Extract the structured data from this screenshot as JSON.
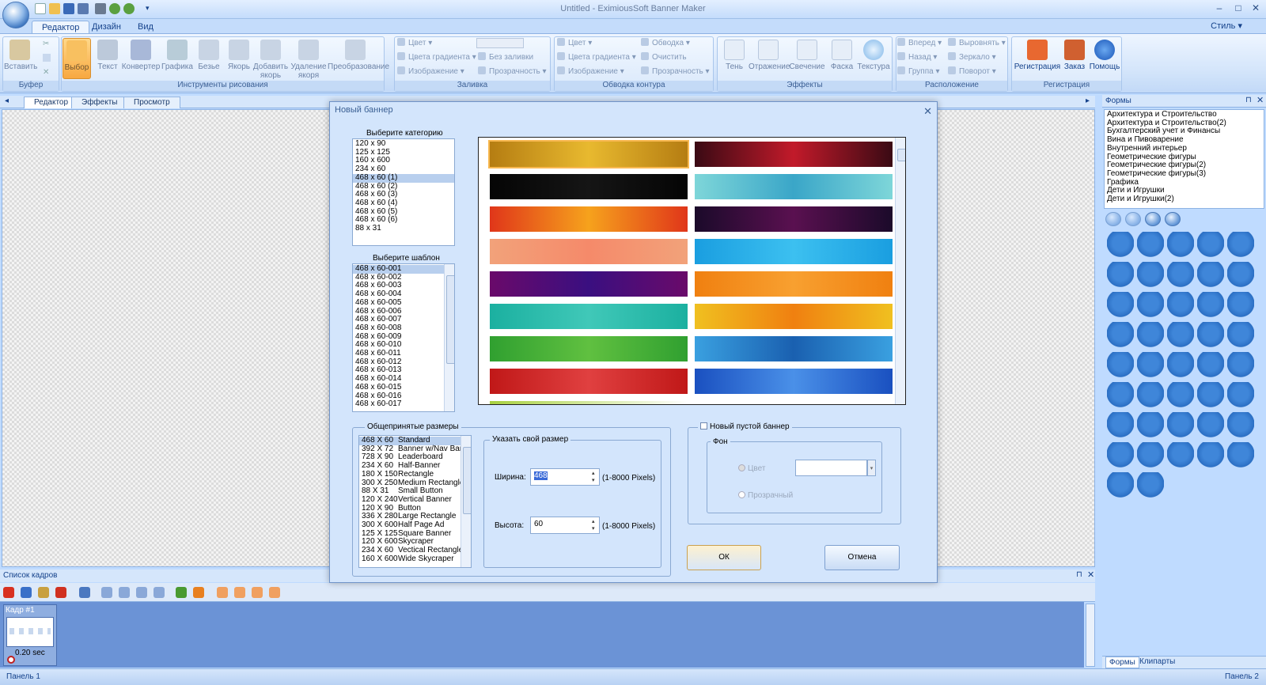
{
  "app": {
    "title": "Untitled - EximiousSoft Banner Maker",
    "style_label": "Стиль"
  },
  "ribbon_tabs": [
    "Редактор",
    "Дизайн",
    "Вид"
  ],
  "ribbon": {
    "groups": [
      {
        "label": "Буфер",
        "buttons": [
          "Вставить"
        ]
      },
      {
        "label": "Инструменты рисования",
        "buttons": [
          "Выбор",
          "Текст",
          "Конвертер",
          "Графика",
          "Безье",
          "Якорь",
          "Добавить якорь",
          "Удаление якоря",
          "Преобразование"
        ]
      },
      {
        "label": "Заливка",
        "items": [
          "Цвет",
          "Цвета градиента",
          "Без заливки",
          "Изображение",
          "Прозрачность"
        ]
      },
      {
        "label": "Обводка контура",
        "items": [
          "Цвет",
          "Обводка",
          "Цвета градиента",
          "Очистить",
          "Изображение",
          "Прозрачность"
        ]
      },
      {
        "label": "Эффекты",
        "buttons": [
          "Тень",
          "Отражение",
          "Свечение",
          "Фаска",
          "Текстура"
        ]
      },
      {
        "label": "Расположение",
        "items": [
          "Вперед",
          "Выровнять",
          "Назад",
          "Зеркало",
          "Группа",
          "Поворот"
        ]
      },
      {
        "label": "Регистрация",
        "buttons": [
          "Регистрация",
          "Заказ",
          "Помощь"
        ]
      }
    ]
  },
  "doc_tabs": [
    "Редактор",
    "Эффекты",
    "Просмотр"
  ],
  "right_panel": {
    "title": "Формы",
    "categories": [
      "Архитектура и Строительство",
      "Архитектура и Строительство(2)",
      "Бухгалтерский учет и Финансы",
      "Вина и Пивоварение",
      "Внутренний интерьер",
      "Геометрические фигуры",
      "Геометрические фигуры(2)",
      "Геометрические фигуры(3)",
      "Графика",
      "Дети и Игрушки",
      "Дети и Игрушки(2)"
    ],
    "tabs": [
      "Формы",
      "Клипарты"
    ],
    "icon_names": [
      "airplane-icon",
      "ski-icon",
      "bug-icon",
      "car-front-icon",
      "car-side-icon",
      "truck-icon",
      "bus-icon",
      "motorbike-icon",
      "boat-icon",
      "van-icon",
      "jeep-icon",
      "rocket-icon",
      "bicycle-icon",
      "scooter-icon",
      "tractor-icon",
      "ship-icon",
      "satellite-icon",
      "jetski-icon",
      "helicopter-icon",
      "gear-icon",
      "van2-icon",
      "bus2-icon",
      "lorry-icon",
      "car2-icon",
      "atv-icon",
      "digger-icon",
      "truck2-icon",
      "plane-icon",
      "missile-icon",
      "cart-icon",
      "spaceship-icon",
      "balloon-icon",
      "bike2-icon",
      "tram-icon",
      "ambulance-icon",
      "jet-icon",
      "helicopter2-icon",
      "steamboat-icon",
      "boat2-icon",
      "sedan-icon",
      "train-icon",
      "bus3-icon"
    ]
  },
  "frames": {
    "title": "Список кадров",
    "frame_label": "Кадр #1",
    "frame_time": "0.20 sec"
  },
  "status": {
    "left": "Панель 1",
    "right": "Панель 2"
  },
  "dialog": {
    "title": "Новый баннер",
    "category_label": "Выберите категорию",
    "categories": [
      "120 x 90",
      "125 x 125",
      "160 x 600",
      "234 x 60",
      "468 x 60 (1)",
      "468 x 60 (2)",
      "468 x 60 (3)",
      "468 x 60 (4)",
      "468 x 60 (5)",
      "468 x 60 (6)",
      "88 x 31"
    ],
    "selected_category": "468 x 60 (1)",
    "template_label": "Выберите шаблон",
    "templates": [
      "468 x 60-001",
      "468 x 60-002",
      "468 x 60-003",
      "468 x 60-004",
      "468 x 60-005",
      "468 x 60-006",
      "468 x 60-007",
      "468 x 60-008",
      "468 x 60-009",
      "468 x 60-010",
      "468 x 60-011",
      "468 x 60-012",
      "468 x 60-013",
      "468 x 60-014",
      "468 x 60-015",
      "468 x 60-016",
      "468 x 60-017"
    ],
    "selected_template": "468 x 60-001",
    "thumb_colors": [
      [
        "#b57d12",
        "#e8b92f"
      ],
      [
        "#3a0a14",
        "#c21a2a"
      ],
      [
        "#050505",
        "#151515"
      ],
      [
        "#7ed6d9",
        "#3aa6c8"
      ],
      [
        "#e0361a",
        "#f6a21c"
      ],
      [
        "#1b0a2a",
        "#5a1050"
      ],
      [
        "#f2a27a",
        "#f58a6a"
      ],
      [
        "#1a9ee0",
        "#3cc0f0"
      ],
      [
        "#6a0a6a",
        "#3a0f80"
      ],
      [
        "#f08010",
        "#f8a030"
      ],
      [
        "#1bb0a0",
        "#40c8b8"
      ],
      [
        "#f0c020",
        "#f08010"
      ],
      [
        "#30a030",
        "#60c040"
      ],
      [
        "#3aa0e0",
        "#1a60b0"
      ],
      [
        "#c01818",
        "#e04040"
      ],
      [
        "#1a50c0",
        "#4a90e8"
      ]
    ],
    "common_sizes_label": "Общепринятые размеры",
    "common_sizes": [
      {
        "size": "468 X 60",
        "name": "Standard"
      },
      {
        "size": "392 X 72",
        "name": "Banner w/Nav Bar"
      },
      {
        "size": "728 X 90",
        "name": "Leaderboard"
      },
      {
        "size": "234 X 60",
        "name": "Half-Banner"
      },
      {
        "size": "180 X 150",
        "name": "Rectangle"
      },
      {
        "size": "300 X 250",
        "name": "Medium Rectangle"
      },
      {
        "size": "88 X 31",
        "name": "Small Button"
      },
      {
        "size": "120 X 240",
        "name": "Vertical Banner"
      },
      {
        "size": "120 X 90",
        "name": "Button"
      },
      {
        "size": "336 X 280",
        "name": "Large Rectangle"
      },
      {
        "size": "300 X 600",
        "name": "Half Page Ad"
      },
      {
        "size": "125 X 125",
        "name": "Square Banner"
      },
      {
        "size": "120 X 600",
        "name": "Skycraper"
      },
      {
        "size": "234 X 60",
        "name": "Vectical Rectangle"
      },
      {
        "size": "160 X 600",
        "name": "Wide Skycraper"
      }
    ],
    "custom_size_label": "Указать свой размер",
    "width_label": "Ширина:",
    "width_value": "468",
    "height_label": "Высота:",
    "height_value": "60",
    "range_hint": "(1-8000 Pixels)",
    "empty_banner_label": "Новый пустой баннер",
    "background_label": "Фон",
    "color_option": "Цвет",
    "transparent_option": "Прозрачный",
    "ok_label": "ОК",
    "cancel_label": "Отмена"
  }
}
